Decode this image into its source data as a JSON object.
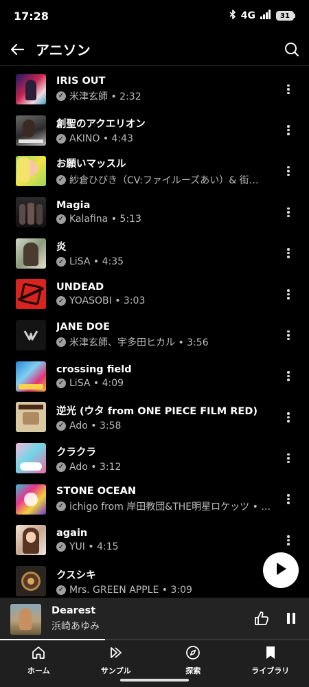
{
  "status_bar": {
    "time": "17:28",
    "network": "4G",
    "battery": "31",
    "icons": [
      "bluetooth-icon",
      "signal-icon",
      "battery-icon"
    ]
  },
  "header": {
    "title": "アニソン",
    "back_icon": "arrow-left-icon",
    "search_icon": "search-icon"
  },
  "tracks": [
    {
      "title": "IRIS OUT",
      "subtitle": "米津玄師 • 2:32"
    },
    {
      "title": "創聖のアクエリオン",
      "subtitle": "AKINO • 4:43"
    },
    {
      "title": "お願いマッスル",
      "subtitle": "紗倉ひびき（CV:ファイルーズあい）& 街…"
    },
    {
      "title": "Magia",
      "subtitle": "Kalafina • 5:13"
    },
    {
      "title": "炎",
      "subtitle": "LiSA • 4:35"
    },
    {
      "title": "UNDEAD",
      "subtitle": "YOASOBI • 3:03"
    },
    {
      "title": "JANE DOE",
      "subtitle": "米津玄師、宇多田ヒカル • 3:56"
    },
    {
      "title": "crossing field",
      "subtitle": "LiSA • 4:09"
    },
    {
      "title": "逆光 (ウタ from ONE PIECE FILM RED)",
      "subtitle": "Ado • 3:58"
    },
    {
      "title": "クラクラ",
      "subtitle": "Ado • 3:12"
    },
    {
      "title": "STONE OCEAN",
      "subtitle": "ichigo from 岸田教団&THE明星ロケッツ • …"
    },
    {
      "title": "again",
      "subtitle": "YUI • 4:15"
    },
    {
      "title": "クスシキ",
      "subtitle": "Mrs. GREEN APPLE • 3:09"
    }
  ],
  "now_playing": {
    "title": "Dearest",
    "artist": "浜崎あゆみ",
    "progress": 0.34
  },
  "nav": {
    "items": [
      {
        "label": "ホーム",
        "icon": "home-icon"
      },
      {
        "label": "サンプル",
        "icon": "samples-icon"
      },
      {
        "label": "探索",
        "icon": "compass-icon"
      },
      {
        "label": "ライブラリ",
        "icon": "library-icon"
      }
    ]
  },
  "colors": {
    "background": "#000000",
    "mini_player_bg": "#232323",
    "nav_bg": "#1f1f1f",
    "secondary_text": "#bdbdbd"
  }
}
